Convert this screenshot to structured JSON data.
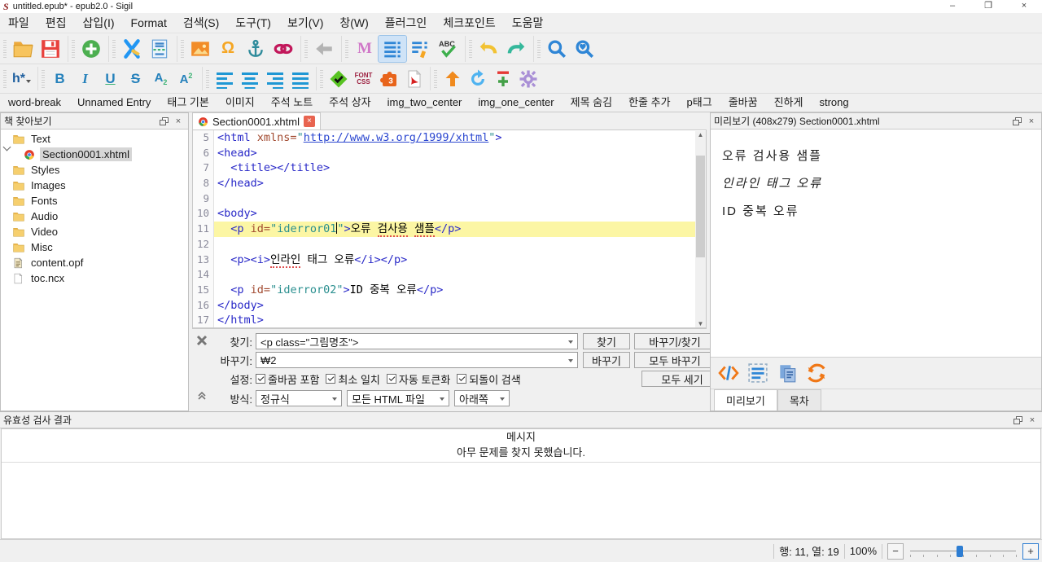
{
  "window": {
    "title": "untitled.epub* - epub2.0 - Sigil",
    "logo": "S",
    "controls": {
      "minimize": "–",
      "restore": "❐",
      "close": "×"
    }
  },
  "menu": [
    "파일",
    "편집",
    "삽입(I)",
    "Format",
    "검색(S)",
    "도구(T)",
    "보기(V)",
    "창(W)",
    "플러그인",
    "체크포인트",
    "도움말"
  ],
  "toolbar_main": {
    "groups": [
      [
        "open-folder",
        "save"
      ],
      [
        "new-section"
      ],
      [
        "cut-x",
        "split-section"
      ],
      [
        "insert-image",
        "special-character",
        "anchor",
        "link"
      ],
      [
        "back-arrow"
      ],
      [
        "metadata-editor",
        "code-view",
        "edit-toc",
        "spellcheck"
      ],
      [
        "undo",
        "redo"
      ],
      [
        "find",
        "find-marked"
      ]
    ],
    "active": "code-view"
  },
  "toolbar_format": {
    "groups": [
      [
        "heading-select"
      ],
      [
        "bold",
        "italic",
        "underline",
        "strikethrough",
        "subscript",
        "superscript"
      ],
      [
        "align-left",
        "align-center",
        "align-right",
        "align-justify"
      ],
      [
        "well-formed-check",
        "font-css",
        "plugin-3",
        "pdf-plugin"
      ],
      [
        "upload",
        "reload",
        "add-remove",
        "settings-gear"
      ]
    ],
    "labels": {
      "heading-select": "h*",
      "bold": "B",
      "italic": "I",
      "underline": "U",
      "strikethrough": "S",
      "subscript": "A₂",
      "superscript": "A²",
      "font-css": "FONT CSS",
      "plugin-3": "3"
    }
  },
  "quick_clips": [
    "word-break",
    "Unnamed Entry",
    "태그 기본",
    "이미지",
    "주석 노트",
    "주석 상자",
    "img_two_center",
    "img_one_center",
    "제목 숨김",
    "한줄 추가",
    "p태그",
    "줄바꿈",
    "진하게",
    "strong"
  ],
  "book_browser": {
    "title": "책 찾아보기",
    "items": [
      {
        "label": "Text",
        "icon": "folder",
        "indent": 0,
        "expanded": true
      },
      {
        "label": "Section0001.xhtml",
        "icon": "html",
        "indent": 1,
        "selected": true
      },
      {
        "label": "Styles",
        "icon": "folder",
        "indent": 0
      },
      {
        "label": "Images",
        "icon": "folder",
        "indent": 0
      },
      {
        "label": "Fonts",
        "icon": "folder",
        "indent": 0
      },
      {
        "label": "Audio",
        "icon": "folder",
        "indent": 0
      },
      {
        "label": "Video",
        "icon": "folder",
        "indent": 0
      },
      {
        "label": "Misc",
        "icon": "folder",
        "indent": 0
      },
      {
        "label": "content.opf",
        "icon": "opf",
        "indent": 0
      },
      {
        "label": "toc.ncx",
        "icon": "ncx",
        "indent": 0
      }
    ]
  },
  "editor": {
    "tab_label": "Section0001.xhtml",
    "lines": [
      {
        "num": 5,
        "tokens": [
          {
            "t": "tag",
            "s": "<html"
          },
          {
            "t": "text",
            "s": " "
          },
          {
            "t": "attr",
            "s": "xmlns="
          },
          {
            "t": "val",
            "s": "\""
          },
          {
            "t": "link",
            "s": "http://www.w3.org/1999/xhtml"
          },
          {
            "t": "val",
            "s": "\""
          },
          {
            "t": "tag",
            "s": ">"
          }
        ]
      },
      {
        "num": 6,
        "tokens": [
          {
            "t": "tag",
            "s": "<head>"
          }
        ]
      },
      {
        "num": 7,
        "tokens": [
          {
            "t": "text",
            "s": "  "
          },
          {
            "t": "tag",
            "s": "<title></title>"
          }
        ]
      },
      {
        "num": 8,
        "tokens": [
          {
            "t": "tag",
            "s": "</head>"
          }
        ]
      },
      {
        "num": 9,
        "tokens": []
      },
      {
        "num": 10,
        "tokens": [
          {
            "t": "tag",
            "s": "<body>"
          }
        ]
      },
      {
        "num": 11,
        "highlight": true,
        "tokens": [
          {
            "t": "text",
            "s": "  "
          },
          {
            "t": "tag",
            "s": "<p"
          },
          {
            "t": "text",
            "s": " "
          },
          {
            "t": "attr",
            "s": "id="
          },
          {
            "t": "val",
            "s": "\"iderror01"
          },
          {
            "t": "caret",
            "s": ""
          },
          {
            "t": "val",
            "s": "\""
          },
          {
            "t": "tag",
            "s": ">"
          },
          {
            "t": "text",
            "s": "오류 "
          },
          {
            "t": "miss",
            "s": "검사용"
          },
          {
            "t": "text",
            "s": " "
          },
          {
            "t": "miss",
            "s": "샘플"
          },
          {
            "t": "tag",
            "s": "</p>"
          }
        ]
      },
      {
        "num": 12,
        "tokens": []
      },
      {
        "num": 13,
        "tokens": [
          {
            "t": "text",
            "s": "  "
          },
          {
            "t": "tag",
            "s": "<p><i>"
          },
          {
            "t": "miss",
            "s": "인라인"
          },
          {
            "t": "text",
            "s": " 태그 오류"
          },
          {
            "t": "tag",
            "s": "</i></p>"
          }
        ]
      },
      {
        "num": 14,
        "tokens": []
      },
      {
        "num": 15,
        "tokens": [
          {
            "t": "text",
            "s": "  "
          },
          {
            "t": "tag",
            "s": "<p"
          },
          {
            "t": "text",
            "s": " "
          },
          {
            "t": "attr",
            "s": "id="
          },
          {
            "t": "val",
            "s": "\"iderror02\""
          },
          {
            "t": "tag",
            "s": ">"
          },
          {
            "t": "text",
            "s": "ID 중복 오류"
          },
          {
            "t": "tag",
            "s": "</p>"
          }
        ]
      },
      {
        "num": 16,
        "tokens": [
          {
            "t": "tag",
            "s": "</body>"
          }
        ]
      },
      {
        "num": 17,
        "tokens": [
          {
            "t": "tag",
            "s": "</html>"
          }
        ]
      }
    ]
  },
  "find_replace": {
    "find_label": "찾기:",
    "find_value": "<p class=\"그림명조\">",
    "replace_label": "바꾸기:",
    "replace_value": "₩2",
    "settings_label": "설정:",
    "options": [
      "줄바꿈 포함",
      "최소 일치",
      "자동 토큰화",
      "되돌이 검색"
    ],
    "mode_label": "방식:",
    "mode_value": "정규식",
    "scope_value": "모든 HTML 파일",
    "direction_value": "아래쪽",
    "find_button": "찾기",
    "replace_find_button": "바꾸기/찾기",
    "replace_button": "바꾸기",
    "replace_all_button": "모두 바꾸기",
    "count_all_button": "모두 세기"
  },
  "preview": {
    "title": "미리보기 (408x279) Section0001.xhtml",
    "paragraphs": [
      {
        "text": "오류 검사용 샘플",
        "style": "normal"
      },
      {
        "text": "인라인 태그 오류",
        "style": "italic"
      },
      {
        "text": "ID 중복 오류",
        "style": "normal"
      }
    ],
    "toolbar": [
      "inspect-code",
      "select-view",
      "copy-view",
      "refresh-preview"
    ],
    "tabs": [
      {
        "label": "미리보기",
        "active": true
      },
      {
        "label": "목차",
        "active": false
      }
    ]
  },
  "validation": {
    "title": "유효성 검사 결과",
    "column_header": "메시지",
    "message": "아무 문제를 찾지 못했습니다."
  },
  "status_bar": {
    "position": "행: 11, 열: 19",
    "zoom": "100%"
  },
  "colors": {
    "accent_blue": "#2d7dd2",
    "highlight_line": "#fcf6a4",
    "tag": "#2929c8",
    "attr": "#a1492f",
    "value": "#2a8f8f",
    "misspell": "#e05050"
  }
}
